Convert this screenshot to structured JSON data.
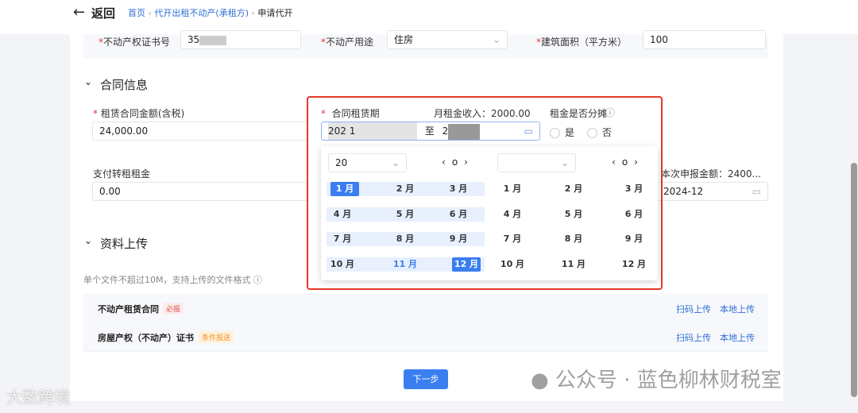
{
  "header": {
    "back": "返回",
    "breadcrumb": [
      "首页",
      "代开出租不动产(承租方)",
      "申请代开"
    ]
  },
  "property": {
    "cert_label": "不动产权证书号",
    "cert_value": "35",
    "use_label": "不动产用途",
    "use_value": "住房",
    "area_label": "建筑面积（平方米）",
    "area_value": "100"
  },
  "contract": {
    "section": "合同信息",
    "amount_label": "租赁合同金额(含税)",
    "amount_value": "24,000.00",
    "period_label": "合同租赁期",
    "period_start": "202  1",
    "period_sep": "至",
    "period_end": "2",
    "monthly": "月租金收入：2000.00",
    "split_label": "租金是否分摊",
    "yes": "是",
    "no": "否",
    "sublet_label": "支付转租租金",
    "sublet_value": "0.00",
    "declare_label": "本次申报金额：2400...",
    "declare_value": "2024-12"
  },
  "picker": {
    "left_year": "20",
    "months": [
      "1 月",
      "2 月",
      "3 月",
      "4 月",
      "5 月",
      "6 月",
      "7 月",
      "8 月",
      "9 月",
      "10 月",
      "11 月",
      "12 月"
    ],
    "prev": "‹",
    "today": "o",
    "next": "›"
  },
  "upload": {
    "section": "资料上传",
    "hint": "单个文件不超过10M，支持上传的文件格式",
    "rows": [
      {
        "name": "不动产租赁合同",
        "tag": "必报",
        "scan": "扫码上传",
        "local": "本地上传"
      },
      {
        "name": "房屋产权（不动产）证书",
        "tag": "条件报送",
        "scan": "扫码上传",
        "local": "本地上传"
      }
    ]
  },
  "next": "下一步",
  "watermark": {
    "left": "大数跨境",
    "right": "公众号 · 蓝色柳林财税室"
  },
  "colors": {
    "accent": "#3b7ef0",
    "highlight": "#e4392b"
  }
}
